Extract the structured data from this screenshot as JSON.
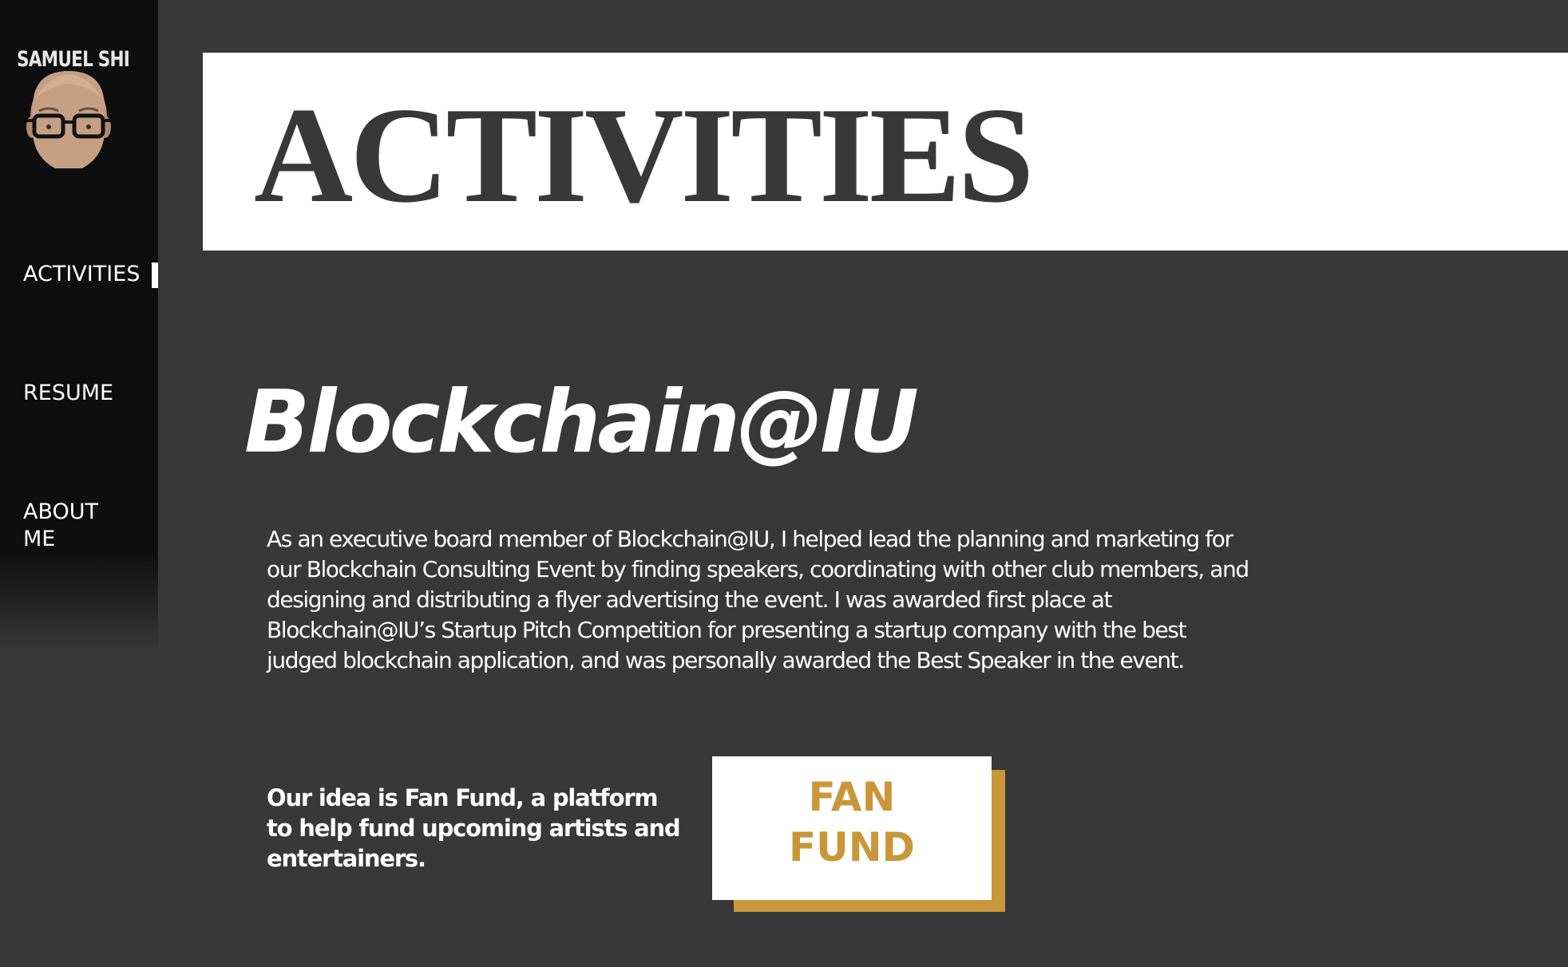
{
  "brand": {
    "name": "SAMUEL SHI"
  },
  "nav": {
    "items": [
      {
        "label": "ACTIVITIES",
        "active": true
      },
      {
        "label": "RESUME",
        "active": false
      },
      {
        "label": "ABOUT ME",
        "active": false
      }
    ]
  },
  "header": {
    "title": "ACTIVITIES"
  },
  "section": {
    "title": "Blockchain@IU",
    "description": "As an executive board member of Blockchain@IU, I helped lead the planning and marketing for our Blockchain Consulting Event by finding speakers, coordinating with other club members, and designing and distributing a flyer advertising the event. I was awarded first place at Blockchain@IU’s Startup Pitch Competition for presenting a startup company with the best judged blockchain application, and was personally awarded the Best Speaker in the event.",
    "idea": "Our idea is Fan Fund, a platform to help fund upcoming artists and entertainers.",
    "logo": {
      "line1": "FAN",
      "line2": "FUND"
    }
  },
  "colors": {
    "background": "#383838",
    "sidebar": "#0e0e0e",
    "accent_gold": "#c9973a",
    "banner": "#ffffff"
  },
  "icons": {
    "avatar": "bald-man-with-glasses-avatar-icon"
  }
}
